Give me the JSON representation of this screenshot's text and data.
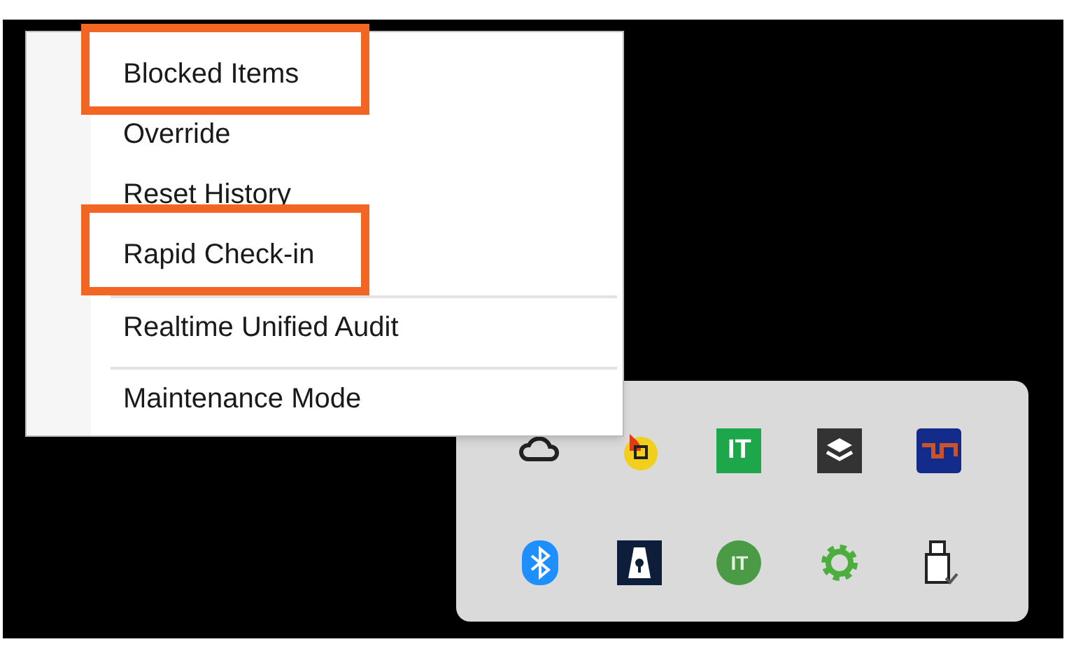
{
  "context_menu": {
    "items": [
      {
        "label": "Blocked Items",
        "separator_before": false,
        "highlighted": true
      },
      {
        "label": "Override",
        "separator_before": false,
        "highlighted": false
      },
      {
        "label": "Reset History",
        "separator_before": false,
        "highlighted": false
      },
      {
        "label": "Rapid Check-in",
        "separator_before": false,
        "highlighted": true
      },
      {
        "label": "Realtime Unified Audit",
        "separator_before": true,
        "highlighted": false
      },
      {
        "label": "Maintenance Mode",
        "separator_before": true,
        "highlighted": false
      }
    ]
  },
  "tray_overflow": {
    "icons": [
      {
        "kind": "cloud"
      },
      {
        "kind": "flame"
      },
      {
        "kind": "text_tile",
        "text": "IT"
      },
      {
        "kind": "layers"
      },
      {
        "kind": "chip"
      },
      {
        "kind": "bluetooth"
      },
      {
        "kind": "lock"
      },
      {
        "kind": "text_badge",
        "text": "IT"
      },
      {
        "kind": "gear"
      },
      {
        "kind": "usb"
      }
    ]
  }
}
